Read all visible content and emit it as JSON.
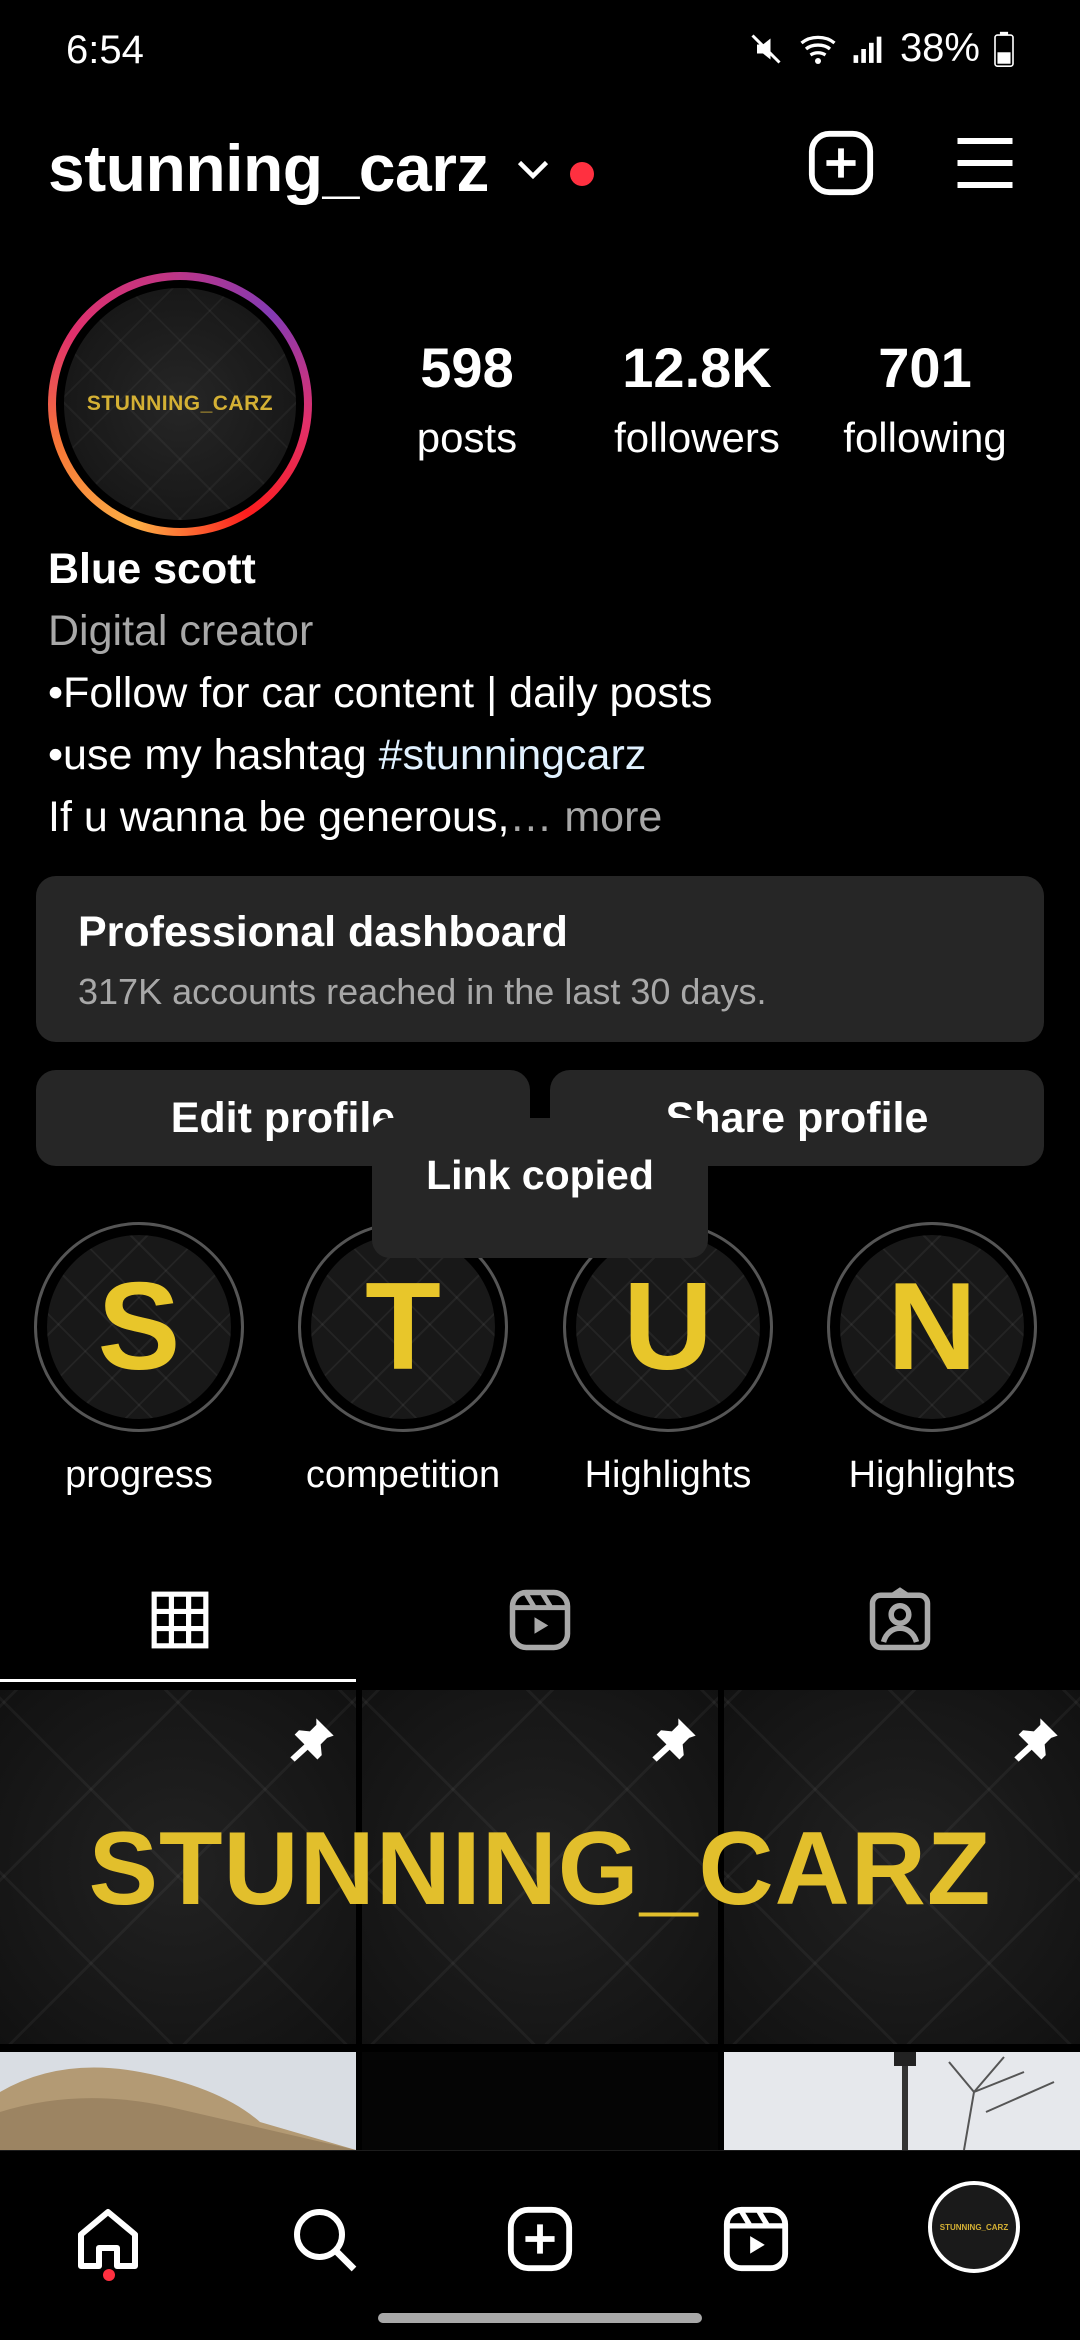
{
  "status_bar": {
    "time": "6:54",
    "battery": "38%"
  },
  "header": {
    "username": "stunning_carz",
    "new_post_icon": "plus-square-icon",
    "menu_icon": "hamburger-menu-icon"
  },
  "profile": {
    "avatar_text": "STUNNING_CARZ",
    "stats": [
      {
        "value": "598",
        "label": "posts"
      },
      {
        "value": "12.8K",
        "label": "followers"
      },
      {
        "value": "701",
        "label": "following"
      }
    ],
    "name": "Blue scott",
    "category": "Digital creator",
    "bio_line1": "•Follow for car content | daily posts",
    "bio_line2_prefix": "•use my hashtag ",
    "bio_hashtag": "#stunningcarz",
    "bio_line3": "If u wanna be generous,",
    "bio_more": "… more"
  },
  "dashboard": {
    "title": "Professional dashboard",
    "subtitle": "317K accounts reached in the last 30 days."
  },
  "buttons": {
    "edit": "Edit profile",
    "share": "Share profile"
  },
  "toast": "Link copied",
  "highlights": [
    {
      "letter": "S",
      "label": "progress"
    },
    {
      "letter": "T",
      "label": "competition"
    },
    {
      "letter": "U",
      "label": "Highlights"
    },
    {
      "letter": "N",
      "label": "Highlights"
    }
  ],
  "tabs": [
    "grid-icon",
    "reels-icon",
    "tagged-icon"
  ],
  "grid": {
    "banner_text": "STUNNING_CARZ"
  },
  "colors": {
    "accent_red": "#ff3040",
    "gold": "#e2bf2c",
    "surface": "#262626"
  }
}
